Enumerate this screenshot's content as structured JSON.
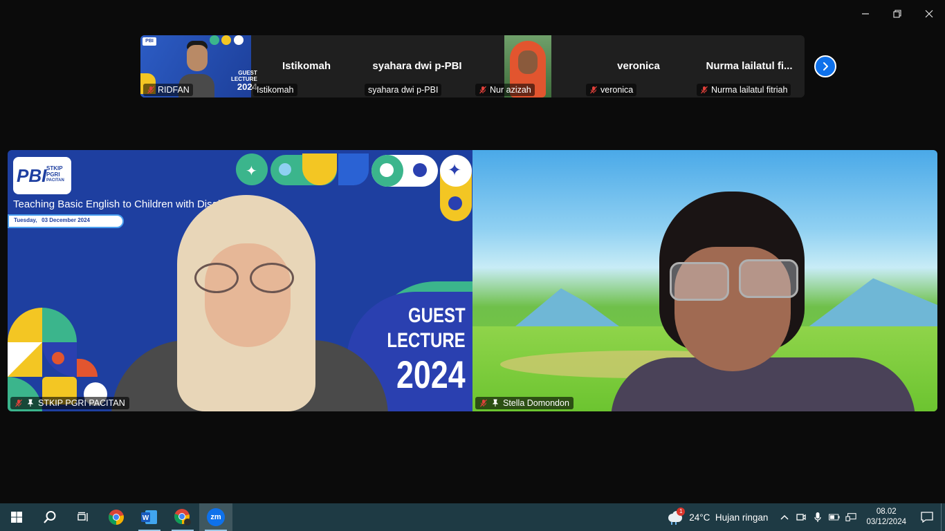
{
  "strip": {
    "tiles": [
      {
        "name": "RIDFAN",
        "muted": true,
        "has_video": true
      },
      {
        "title": "Istikomah",
        "name": "Istikomah",
        "muted": false,
        "has_video": false
      },
      {
        "title": "syahara dwi p-PBI",
        "name": "syahara dwi p-PBI",
        "muted": false,
        "has_video": false
      },
      {
        "name": "Nur azizah",
        "muted": true,
        "has_video": true
      },
      {
        "title": "veronica",
        "name": "veronica",
        "muted": true,
        "has_video": false
      },
      {
        "title": "Nurma  lailatul  fi...",
        "name": "Nurma lailatul fitriah",
        "muted": true,
        "has_video": false
      }
    ],
    "ridfan_thumb": {
      "logo": "PBI",
      "line1": "GUEST",
      "line2": "LECTURE",
      "year": "2024"
    }
  },
  "main": {
    "left": {
      "name": "STKIP PGRI PACITAN",
      "logo_main": "PBI",
      "logo_sub1": "STKIP",
      "logo_sub2": "PGRI",
      "logo_sub3": "PACITAN",
      "headline": "Teaching Basic English to Children with Disabilities",
      "date": "Tuesday,   03 December 2024",
      "guest": "GUEST",
      "lecture": "LECTURE",
      "year": "2024"
    },
    "right": {
      "name": "Stella Domondon"
    }
  },
  "taskbar": {
    "weather_badge": "1",
    "weather": "24°C  Hujan ringan",
    "time": "08.02",
    "date": "03/12/2024",
    "zoom_label": "zm"
  },
  "colors": {
    "zoom_blue": "#0e71eb",
    "mute_red": "#e0403a",
    "taskbar": "#1e3a44",
    "slide_blue": "#1e3fa0"
  }
}
